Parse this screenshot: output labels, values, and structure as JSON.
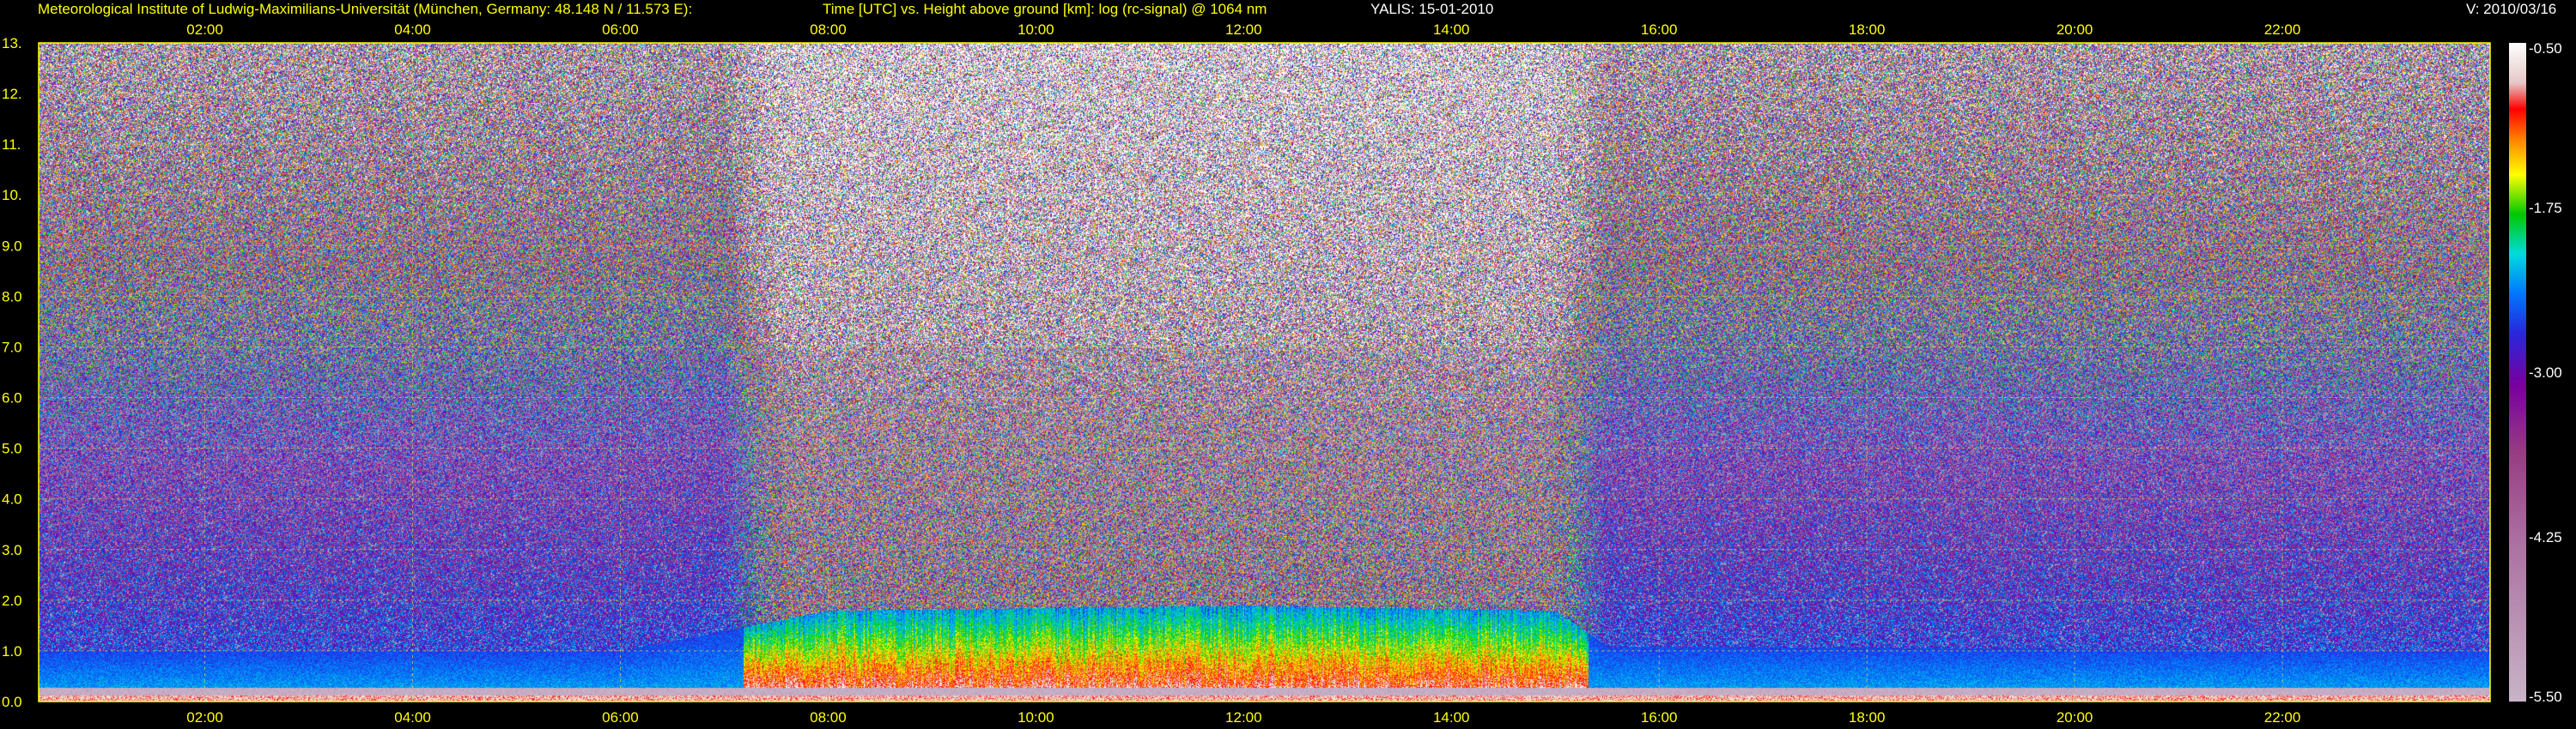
{
  "header": {
    "institute": "Meteorological Institute of Ludwig-Maximilians-Universität (München, Germany: 48.148 N / 11.573 E):",
    "title": "Time [UTC] vs. Height above ground [km]: log (rc-signal) @ 1064 nm",
    "instrument": "YALIS: 15-01-2010",
    "version": "V: 2010/03/16"
  },
  "chart_data": {
    "type": "heatmap",
    "title": "Time [UTC] vs. Height above ground [km]: log (rc-signal) @ 1064 nm",
    "xlabel": "Time [UTC]",
    "ylabel": "Height above ground [km]",
    "x_range_hours": [
      0.4,
      24
    ],
    "y_range_km": [
      0,
      13
    ],
    "x_ticks": [
      "02:00",
      "04:00",
      "06:00",
      "08:00",
      "10:00",
      "12:00",
      "14:00",
      "16:00",
      "18:00",
      "20:00",
      "22:00"
    ],
    "y_ticks": [
      "0.0",
      "1.0",
      "2.0",
      "3.0",
      "4.0",
      "5.0",
      "6.0",
      "7.0",
      "8.0",
      "9.0",
      "10.",
      "11.",
      "12.",
      "13."
    ],
    "colorbar": {
      "label": "log (rc-signal)",
      "ticks": [
        "-0.50",
        "-1.75",
        "-3.00",
        "-4.25",
        "-5.50"
      ],
      "range": [
        -5.5,
        -0.5
      ]
    },
    "grid": true,
    "boundary_layer_top_km": [
      {
        "time": "00:30",
        "height": 1.0
      },
      {
        "time": "06:00",
        "height": 1.0
      },
      {
        "time": "07:30",
        "height": 1.6
      },
      {
        "time": "08:00",
        "height": 1.8
      },
      {
        "time": "12:00",
        "height": 1.9
      },
      {
        "time": "15:00",
        "height": 1.8
      },
      {
        "time": "15:30",
        "height": 1.1
      },
      {
        "time": "24:00",
        "height": 1.0
      }
    ],
    "daylight_noise_period": [
      "07:00",
      "15:30"
    ]
  },
  "colors": {
    "header_text": "#ffff00",
    "axis_text": "#ffff00",
    "grid": "#c8c864",
    "background": "#000000"
  }
}
